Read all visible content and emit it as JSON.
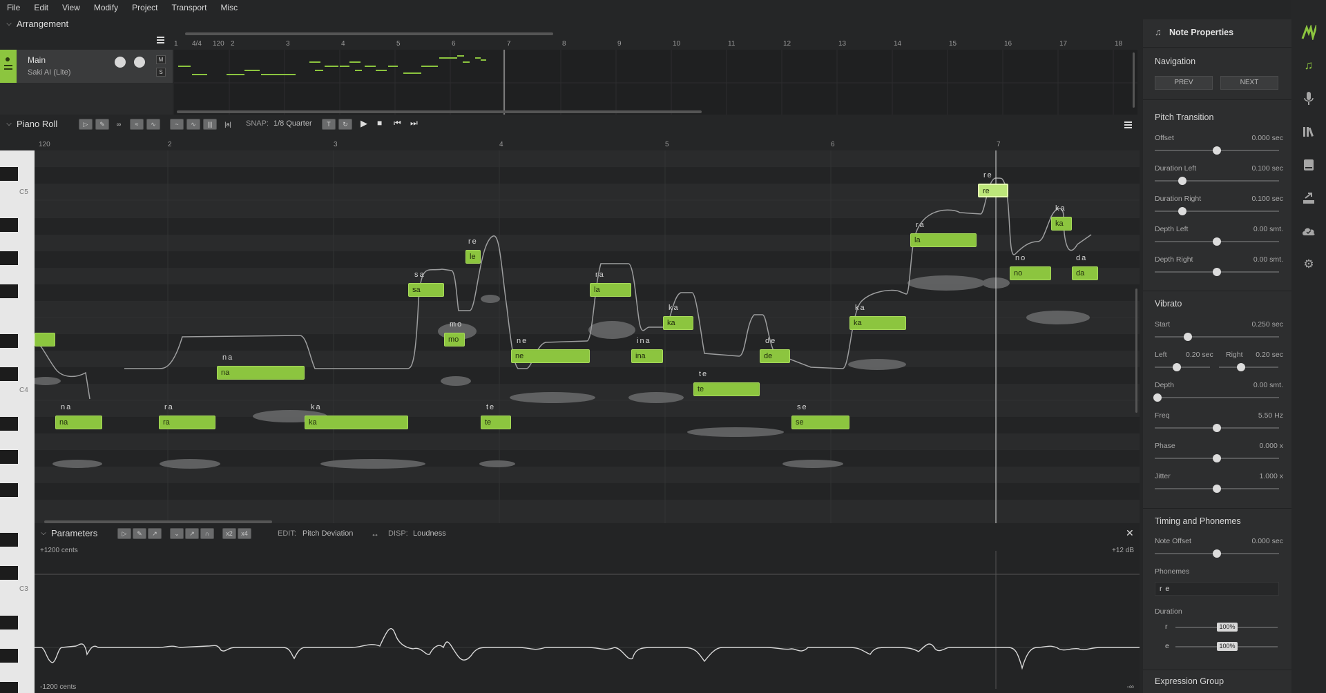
{
  "menu": [
    "File",
    "Edit",
    "View",
    "Modify",
    "Project",
    "Transport",
    "Misc"
  ],
  "arrangement": {
    "title": "Arrangement",
    "ruler": [
      "1",
      "4/4",
      "120",
      "2",
      "3",
      "4",
      "5",
      "6",
      "7",
      "8",
      "9",
      "10",
      "11",
      "12",
      "13",
      "14",
      "15",
      "16",
      "17",
      "18"
    ],
    "track": {
      "name": "Main",
      "voice": "Saki AI (Lite)",
      "mute": "M",
      "solo": "S"
    }
  },
  "piano_roll": {
    "title": "Piano Roll",
    "snap_label": "SNAP:",
    "snap_value": "1/8 Quarter",
    "ruler": [
      "120",
      "2",
      "3",
      "4",
      "5",
      "6",
      "7"
    ],
    "key_labels": [
      "C5",
      "C4",
      "C3"
    ],
    "notes": [
      {
        "lyric": "na",
        "text": "na"
      },
      {
        "lyric": "ra",
        "text": "ra"
      },
      {
        "lyric": "na",
        "text": "na"
      },
      {
        "lyric": "ka",
        "text": "ka"
      },
      {
        "lyric": "sa",
        "text": "sa"
      },
      {
        "lyric": "mo",
        "text": "mo"
      },
      {
        "lyric": "re",
        "text": "le"
      },
      {
        "lyric": "te",
        "text": "te"
      },
      {
        "lyric": "ne",
        "text": "ne"
      },
      {
        "lyric": "ra",
        "text": "la"
      },
      {
        "lyric": "ina",
        "text": "ina"
      },
      {
        "lyric": "ka",
        "text": "ka"
      },
      {
        "lyric": "te",
        "text": "te"
      },
      {
        "lyric": "de",
        "text": "de"
      },
      {
        "lyric": "se",
        "text": "se"
      },
      {
        "lyric": "ka",
        "text": "ka"
      },
      {
        "lyric": "ra",
        "text": "la"
      },
      {
        "lyric": "re",
        "text": "re"
      },
      {
        "lyric": "no",
        "text": "no"
      },
      {
        "lyric": "ka",
        "text": "ka"
      },
      {
        "lyric": "da",
        "text": "da"
      }
    ]
  },
  "parameters": {
    "title": "Parameters",
    "edit_label": "EDIT:",
    "edit_value": "Pitch Deviation",
    "disp_label": "DISP:",
    "disp_value": "Loudness",
    "top_left": "+1200 cents",
    "bottom_left": "-1200 cents",
    "top_right": "+12 dB",
    "bottom_right": "-∞"
  },
  "note_properties": {
    "title": "Note Properties",
    "navigation": {
      "title": "Navigation",
      "prev": "PREV",
      "next": "NEXT"
    },
    "pitch_transition": {
      "title": "Pitch Transition",
      "fields": [
        {
          "label": "Offset",
          "value": "0.000 sec",
          "level": 0.5
        },
        {
          "label": "Duration Left",
          "value": "0.100 sec",
          "level": 0.2
        },
        {
          "label": "Duration Right",
          "value": "0.100 sec",
          "level": 0.2
        },
        {
          "label": "Depth Left",
          "value": "0.00 smt.",
          "level": 0.5
        },
        {
          "label": "Depth Right",
          "value": "0.00 smt.",
          "level": 0.5
        }
      ]
    },
    "vibrato": {
      "title": "Vibrato",
      "start": {
        "label": "Start",
        "value": "0.250 sec",
        "level": 0.25
      },
      "left": {
        "label": "Left",
        "value": "0.20 sec",
        "level": 0.4
      },
      "right": {
        "label": "Right",
        "value": "0.20 sec",
        "level": 0.4
      },
      "depth": {
        "label": "Depth",
        "value": "0.00 smt.",
        "level": 0.0
      },
      "freq": {
        "label": "Freq",
        "value": "5.50 Hz",
        "level": 0.5
      },
      "phase": {
        "label": "Phase",
        "value": "0.000 x",
        "level": 0.5
      },
      "jitter": {
        "label": "Jitter",
        "value": "1.000 x",
        "level": 0.5
      }
    },
    "timing": {
      "title": "Timing and Phonemes",
      "note_offset": {
        "label": "Note Offset",
        "value": "0.000 sec",
        "level": 0.5
      },
      "phonemes_label": "Phonemes",
      "phonemes_value": "r e",
      "duration_label": "Duration",
      "duration_rows": [
        {
          "phoneme": "r",
          "value": "100%"
        },
        {
          "phoneme": "e",
          "value": "100%"
        }
      ]
    },
    "expression_group": "Expression Group"
  },
  "sidebar_icons": [
    "logo-icon",
    "note-icon",
    "microphone-icon",
    "library-icon",
    "book-icon",
    "export-icon",
    "cloud-icon",
    "settings-icon"
  ],
  "colors": {
    "accent": "#8cc53f",
    "selected": "#bde67a",
    "background": "#252627"
  }
}
